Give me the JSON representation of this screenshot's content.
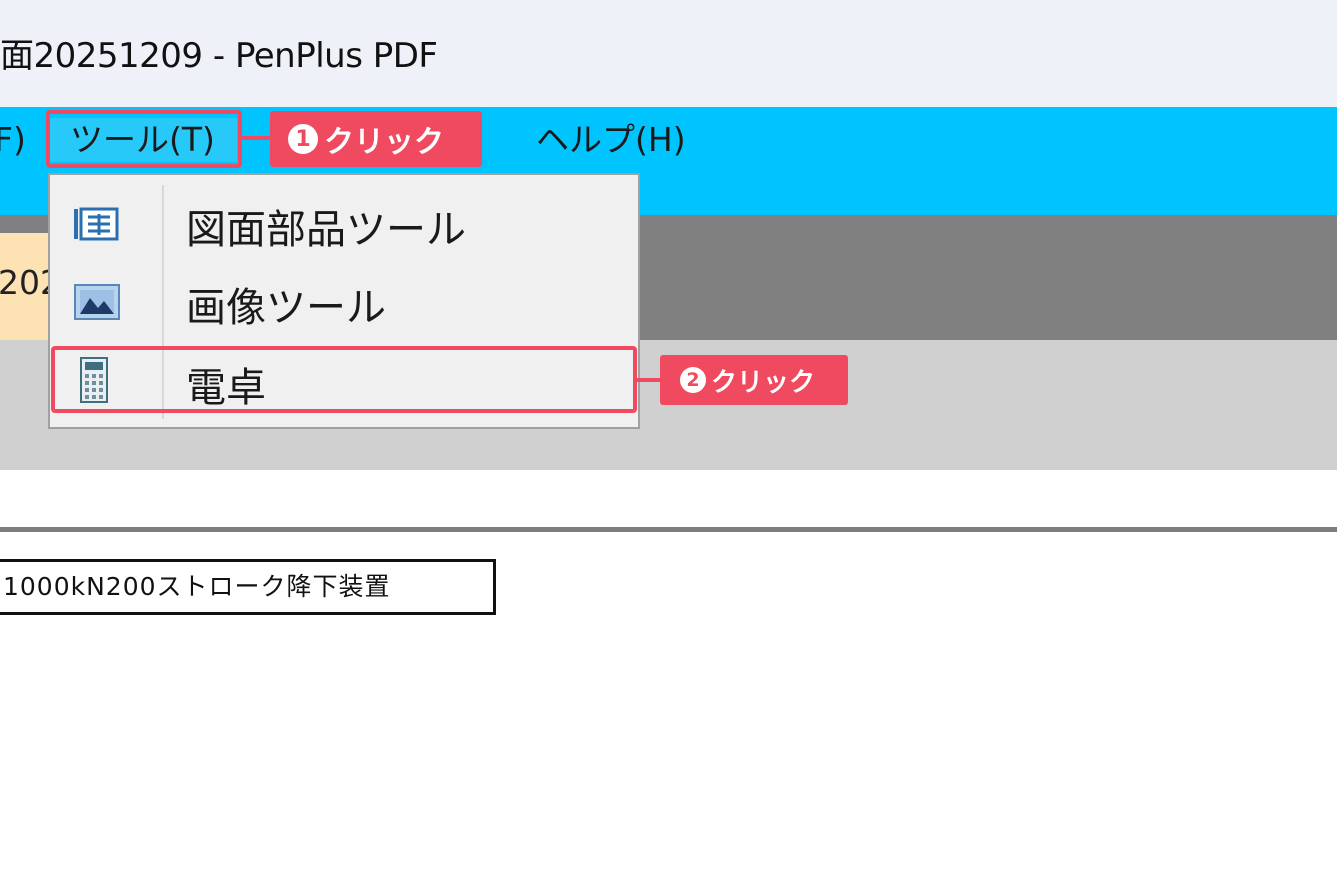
{
  "window": {
    "title": "面20251209 - PenPlus PDF"
  },
  "menubar": {
    "file_label": "F)",
    "tools_label": "ツール(T)",
    "help_label": "ヘルプ(H)"
  },
  "tools_menu": {
    "items": [
      {
        "label": "図面部品ツール",
        "icon": "drawing-parts-icon"
      },
      {
        "label": "画像ツール",
        "icon": "image-icon"
      },
      {
        "label": "電卓",
        "icon": "calculator-icon"
      }
    ]
  },
  "callouts": [
    {
      "number": "1",
      "text": "クリック"
    },
    {
      "number": "2",
      "text": "クリック"
    }
  ],
  "document": {
    "tab_text": "202",
    "title_block_text": "1000kN200ストローク降下装置"
  },
  "colors": {
    "menubar": "#00c4fd",
    "callout": "#f04a60",
    "tab": "#fde3b4"
  }
}
